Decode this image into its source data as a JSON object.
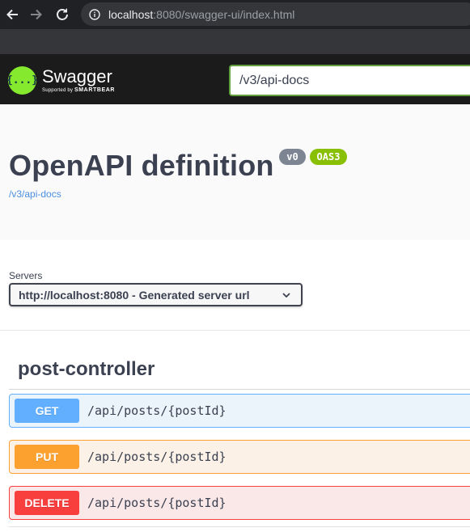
{
  "browser": {
    "url_host": "localhost",
    "url_rest": ":8080/swagger-ui/index.html",
    "icons": [
      "back-arrow-icon",
      "forward-arrow-icon",
      "reload-icon",
      "info-icon"
    ]
  },
  "topbar": {
    "logo_mark": "{...}",
    "logo_name": "Swagger",
    "logo_tag_prefix": "Supported by",
    "logo_tag_brand": "SMARTBEAR",
    "spec_url_value": "/v3/api-docs"
  },
  "info": {
    "title": "OpenAPI definition",
    "version_badge": "v0",
    "oas_badge": "OAS3",
    "spec_link": "/v3/api-docs"
  },
  "servers": {
    "label": "Servers",
    "selected": "http://localhost:8080 - Generated server url"
  },
  "tag": {
    "name": "post-controller",
    "operations": [
      {
        "method": "GET",
        "path": "/api/posts/{postId}",
        "color": "#61affe"
      },
      {
        "method": "PUT",
        "path": "/api/posts/{postId}",
        "color": "#fca130"
      },
      {
        "method": "DELETE",
        "path": "/api/posts/{postId}",
        "color": "#f93e3e"
      }
    ]
  },
  "colors": {
    "topbar_bg": "#1b1b1b",
    "swagger_green": "#85ea2d",
    "title_text": "#3b4151",
    "link": "#4990e2"
  }
}
